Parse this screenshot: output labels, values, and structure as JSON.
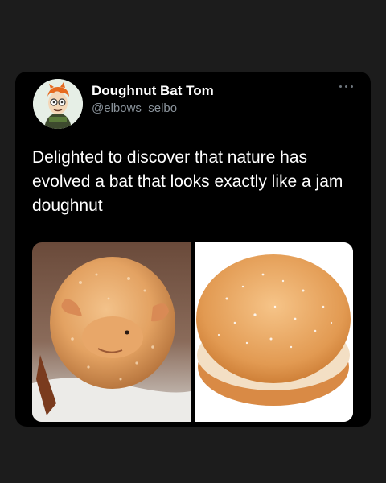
{
  "tweet": {
    "author": {
      "display_name": "Doughnut Bat Tom",
      "handle": "@elbows_selbo",
      "avatar_icon": "cartoon-avatar"
    },
    "text": "Delighted to discover that nature has evolved a bat that looks exactly like a jam doughnut",
    "more_icon": "more-options-icon",
    "media": [
      {
        "kind": "photo",
        "subject": "bat"
      },
      {
        "kind": "photo",
        "subject": "jam-doughnut"
      }
    ]
  },
  "colors": {
    "page_background": "#1c1c1c",
    "card_background": "#000000",
    "primary_text": "#ffffff",
    "secondary_text": "#8b949c"
  }
}
